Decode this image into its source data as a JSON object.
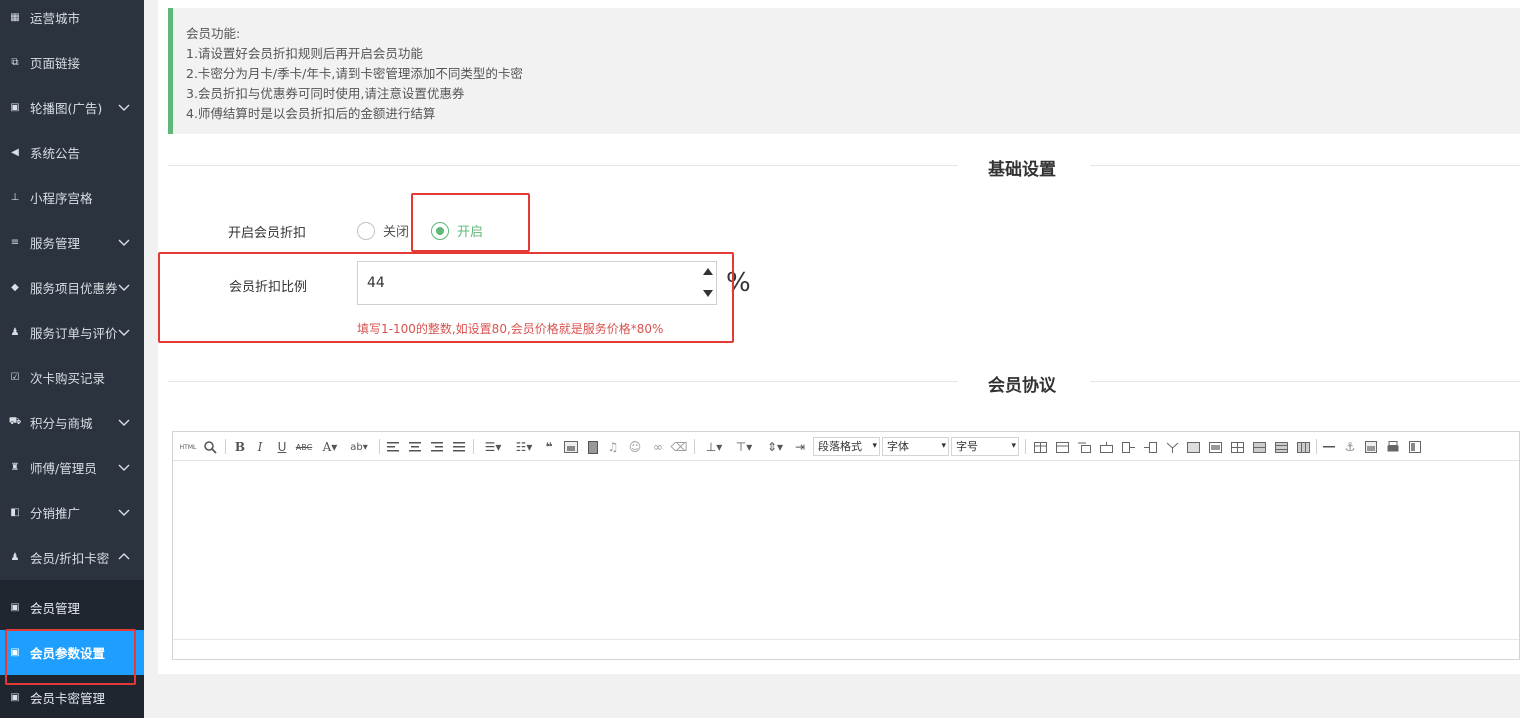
{
  "sidebar": {
    "items": [
      {
        "label": "运营城市",
        "icon": "building-icon",
        "chevron": ""
      },
      {
        "label": "页面链接",
        "icon": "link-icon",
        "chevron": ""
      },
      {
        "label": "轮播图(广告)",
        "icon": "image-icon",
        "chevron": "down"
      },
      {
        "label": "系统公告",
        "icon": "speaker-icon",
        "chevron": ""
      },
      {
        "label": "小程序宫格",
        "icon": "sitemap-icon",
        "chevron": ""
      },
      {
        "label": "服务管理",
        "icon": "list-icon",
        "chevron": "down"
      },
      {
        "label": "服务项目优惠券",
        "icon": "tag-icon",
        "chevron": "down"
      },
      {
        "label": "服务订单与评价",
        "icon": "thumb-icon",
        "chevron": "down"
      },
      {
        "label": "次卡购买记录",
        "icon": "checkbox-icon",
        "chevron": ""
      },
      {
        "label": "积分与商城",
        "icon": "cart-icon",
        "chevron": "down"
      },
      {
        "label": "师傅/管理员",
        "icon": "wrench-icon",
        "chevron": "down"
      },
      {
        "label": "分销推广",
        "icon": "share-icon",
        "chevron": "down"
      },
      {
        "label": "会员/折扣卡密",
        "icon": "user-icon",
        "chevron": "up"
      }
    ],
    "sub_items": [
      {
        "label": "会员管理",
        "icon": "image-icon"
      },
      {
        "label": "会员参数设置",
        "icon": "image-icon",
        "active": true
      },
      {
        "label": "会员卡密管理",
        "icon": "image-icon"
      }
    ]
  },
  "notice": {
    "lines": [
      "会员功能:",
      "1.请设置好会员折扣规则后再开启会员功能",
      "2.卡密分为月卡/季卡/年卡,请到卡密管理添加不同类型的卡密",
      "3.会员折扣与优惠券可同时使用,请注意设置优惠券",
      "4.师傅结算时是以会员折扣后的金额进行结算"
    ]
  },
  "basic": {
    "title": "基础设置",
    "enable_label": "开启会员折扣",
    "radio_off": "关闭",
    "radio_on": "开启",
    "selected": "开启",
    "ratio_label": "会员折扣比例",
    "ratio_value": "44",
    "unit": "%",
    "hint": "填写1-100的整数,如设置80,会员价格就是服务价格*80%"
  },
  "agreement": {
    "title": "会员协议"
  },
  "editor": {
    "html_label": "HTML",
    "paragraph_select": "段落格式",
    "font_select": "字体",
    "size_select": "字号"
  },
  "colors": {
    "sidebar_bg": "#2b333e",
    "active": "#1e9fff",
    "success": "#5fb878",
    "danger": "#e53935"
  }
}
